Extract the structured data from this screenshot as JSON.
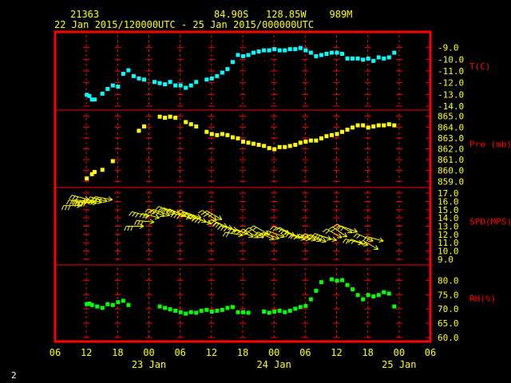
{
  "header": {
    "station": "21363",
    "location": "84.90S   128.85W    989M",
    "period": "22 Jan 2015/120000UTC - 25 Jan 2015/000000UTC"
  },
  "footer": {
    "page_number": "2"
  },
  "colors": {
    "frame": "#ff0000",
    "grid": "#ff0000",
    "temperature": "#00ffff",
    "pressure": "#ffff00",
    "wind": "#ffff00",
    "humidity": "#00ff00",
    "axis_text": "#ffff00",
    "panel_label": "#ff0000",
    "background": "#000000"
  },
  "chart_data": {
    "type": "scatter",
    "x_unit": "hours since 22 Jan 2015 06 UTC",
    "x_range": [
      0,
      72
    ],
    "x_ticks": [
      {
        "h": 0,
        "label": "06"
      },
      {
        "h": 6,
        "label": "12"
      },
      {
        "h": 12,
        "label": "18"
      },
      {
        "h": 18,
        "label": "00"
      },
      {
        "h": 24,
        "label": "06"
      },
      {
        "h": 30,
        "label": "12"
      },
      {
        "h": 36,
        "label": "18"
      },
      {
        "h": 42,
        "label": "00"
      },
      {
        "h": 48,
        "label": "06"
      },
      {
        "h": 54,
        "label": "12"
      },
      {
        "h": 60,
        "label": "18"
      },
      {
        "h": 66,
        "label": "00"
      },
      {
        "h": 72,
        "label": "06"
      }
    ],
    "date_labels": [
      {
        "h": 18,
        "label": "23 Jan"
      },
      {
        "h": 42,
        "label": "24 Jan"
      },
      {
        "h": 66,
        "label": "25 Jan"
      }
    ],
    "panels": [
      {
        "id": "temperature",
        "label": "T(C)",
        "ylim": [
          -14.0,
          -8.0
        ],
        "ticks": [
          -14.0,
          -13.0,
          -12.0,
          -11.0,
          -10.0,
          -9.0
        ],
        "tick_labels": [
          "-14.0",
          "-13.0",
          "-12.0",
          "-11.0",
          "-10.0",
          "-9.0"
        ],
        "x": [
          6,
          6.5,
          7,
          7.5,
          9,
          10,
          11,
          12,
          13,
          14,
          15,
          16,
          17,
          19,
          20,
          21,
          22,
          23,
          24,
          25,
          26,
          27,
          29,
          30,
          31,
          32,
          33,
          34,
          35,
          36,
          37,
          38,
          39,
          40,
          41,
          42,
          43,
          44,
          45,
          46,
          47,
          48,
          49,
          50,
          51,
          52,
          53,
          54,
          55,
          56,
          57,
          58,
          59,
          60,
          61,
          62,
          63,
          64,
          65
        ],
        "y": [
          -13.0,
          -13.1,
          -13.4,
          -13.4,
          -12.9,
          -12.5,
          -12.2,
          -12.3,
          -11.2,
          -10.9,
          -11.4,
          -11.6,
          -11.7,
          -11.9,
          -12.0,
          -12.1,
          -11.9,
          -12.2,
          -12.2,
          -12.4,
          -12.2,
          -11.9,
          -11.7,
          -11.6,
          -11.4,
          -11.1,
          -10.8,
          -10.2,
          -9.6,
          -9.7,
          -9.6,
          -9.4,
          -9.3,
          -9.2,
          -9.2,
          -9.1,
          -9.2,
          -9.2,
          -9.1,
          -9.1,
          -9.0,
          -9.2,
          -9.4,
          -9.7,
          -9.6,
          -9.5,
          -9.4,
          -9.4,
          -9.5,
          -9.9,
          -9.9,
          -9.9,
          -10.0,
          -9.9,
          -10.1,
          -9.8,
          -9.9,
          -9.8,
          -9.4
        ]
      },
      {
        "id": "pressure",
        "label": "Pre (mb)",
        "ylim": [
          858.8,
          865.2
        ],
        "ticks": [
          859.0,
          860.0,
          861.0,
          862.0,
          863.0,
          864.0,
          865.0
        ],
        "tick_labels": [
          "859.0",
          "860.0",
          "861.0",
          "862.0",
          "863.0",
          "864.0",
          "865.0"
        ],
        "x": [
          6,
          7,
          7.5,
          9,
          11,
          16,
          17,
          20,
          21,
          22,
          23,
          25,
          26,
          27,
          29,
          30,
          31,
          32,
          33,
          34,
          35,
          36,
          37,
          38,
          39,
          40,
          41,
          42,
          43,
          44,
          45,
          46,
          47,
          48,
          49,
          50,
          51,
          52,
          53,
          54,
          55,
          56,
          57,
          58,
          59,
          60,
          61,
          62,
          63,
          64,
          65
        ],
        "y": [
          859.3,
          859.7,
          859.9,
          860.1,
          860.9,
          863.7,
          864.1,
          865.0,
          864.9,
          865.0,
          864.9,
          864.5,
          864.3,
          864.1,
          863.6,
          863.4,
          863.3,
          863.4,
          863.3,
          863.1,
          863.0,
          862.7,
          862.6,
          862.5,
          862.4,
          862.3,
          862.1,
          862.0,
          862.2,
          862.2,
          862.3,
          862.4,
          862.6,
          862.7,
          862.8,
          862.8,
          863.0,
          863.2,
          863.3,
          863.4,
          863.6,
          863.8,
          864.0,
          864.2,
          864.2,
          864.0,
          864.1,
          864.2,
          864.2,
          864.3,
          864.2
        ]
      },
      {
        "id": "wind",
        "label": "SPD(MPS)",
        "ylim": [
          8.8,
          17.2
        ],
        "ticks": [
          9.0,
          10.0,
          11.0,
          12.0,
          13.0,
          14.0,
          15.0,
          16.0,
          17.0
        ],
        "tick_labels": [
          "9.0",
          "10.0",
          "11.0",
          "12.0",
          "13.0",
          "14.0",
          "15.0",
          "16.0",
          "17.0"
        ],
        "x": [
          5,
          6,
          6.5,
          7,
          7.5,
          8,
          9,
          10,
          11,
          17,
          18,
          19,
          20,
          21,
          22,
          23,
          24,
          25,
          26,
          27,
          28,
          29,
          30,
          31,
          32,
          33,
          34,
          35,
          36,
          37,
          38,
          39,
          40,
          41,
          42,
          43,
          44,
          45,
          46,
          47,
          48,
          49,
          50,
          51,
          52,
          53,
          54,
          55,
          56,
          57,
          58,
          59,
          60,
          61,
          62,
          63
        ],
        "speed": [
          15.5,
          15.8,
          16.2,
          16.0,
          15.9,
          15.8,
          15.9,
          16.0,
          16.2,
          13.0,
          14.2,
          13.5,
          14.0,
          14.2,
          14.3,
          14.5,
          14.5,
          14.2,
          14.0,
          13.9,
          14.0,
          13.5,
          13.3,
          13.7,
          13.8,
          12.9,
          12.7,
          12.5,
          11.9,
          12.1,
          11.7,
          11.6,
          11.6,
          12.0,
          11.4,
          11.5,
          11.7,
          12.1,
          11.8,
          11.6,
          11.4,
          11.4,
          11.3,
          11.2,
          11.1,
          11.4,
          11.3,
          11.6,
          11.7,
          12.2,
          12.3,
          10.9,
          10.7,
          11.2,
          10.2,
          11.2
        ],
        "direction_deg": [
          270,
          260,
          255,
          265,
          270,
          265,
          260,
          255,
          260,
          270,
          255,
          265,
          255,
          245,
          250,
          245,
          250,
          245,
          255,
          240,
          250,
          245,
          250,
          235,
          240,
          245,
          250,
          255,
          260,
          255,
          245,
          240,
          235,
          240,
          245,
          250,
          250,
          245,
          240,
          245,
          250,
          255,
          250,
          245,
          245,
          250,
          255,
          240,
          235,
          240,
          250,
          255,
          250,
          245,
          240,
          255
        ]
      },
      {
        "id": "humidity",
        "label": "RH(%)",
        "ylim": [
          60.0,
          84.0
        ],
        "ticks": [
          60.0,
          65.0,
          70.0,
          75.0,
          80.0
        ],
        "tick_labels": [
          "60.0",
          "65.0",
          "70.0",
          "75.0",
          "80.0"
        ],
        "x": [
          6,
          6.5,
          7,
          8,
          9,
          10,
          11,
          12,
          13,
          14,
          20,
          21,
          22,
          23,
          24,
          25,
          26,
          27,
          28,
          29,
          30,
          31,
          32,
          33,
          34,
          35,
          36,
          37,
          40,
          41,
          42,
          43,
          44,
          45,
          46,
          47,
          48,
          49,
          50,
          51,
          53,
          54,
          55,
          56,
          57,
          58,
          59,
          60,
          61,
          62,
          63,
          64,
          65
        ],
        "y": [
          71.8,
          72.0,
          71.5,
          71.0,
          70.5,
          71.8,
          71.5,
          72.5,
          73.0,
          71.5,
          71.0,
          70.5,
          70.0,
          69.5,
          69.0,
          68.5,
          69.0,
          68.8,
          69.5,
          69.8,
          69.2,
          69.5,
          69.8,
          70.5,
          70.8,
          69.0,
          69.0,
          68.8,
          69.2,
          68.8,
          69.2,
          69.5,
          69.0,
          69.5,
          70.2,
          70.8,
          71.2,
          73.5,
          76.5,
          79.5,
          80.5,
          80.0,
          80.2,
          78.5,
          77.0,
          75.0,
          73.5,
          75.0,
          74.5,
          75.0,
          76.0,
          75.5,
          71.0
        ]
      }
    ]
  }
}
